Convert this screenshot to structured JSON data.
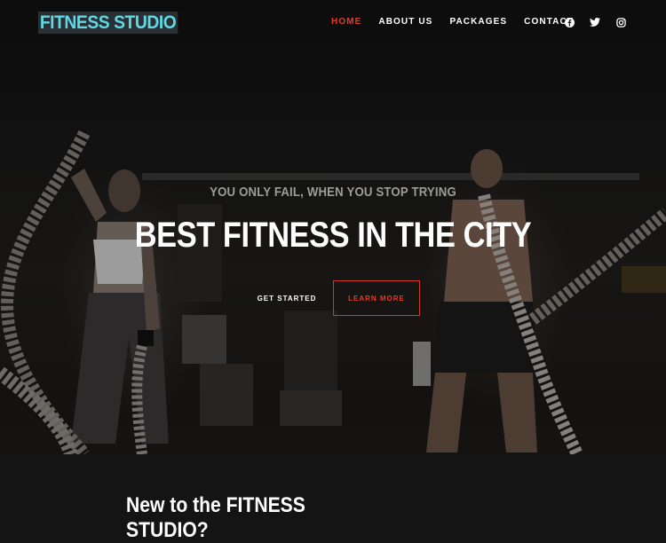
{
  "brand": {
    "logo_text": "FITNESS STUDIO"
  },
  "nav": {
    "items": [
      {
        "label": "HOME",
        "active": true
      },
      {
        "label": "ABOUT US",
        "active": false
      },
      {
        "label": "PACKAGES",
        "active": false
      },
      {
        "label": "CONTACT",
        "active": false
      }
    ],
    "social_icons": [
      "facebook-icon",
      "twitter-icon",
      "instagram-icon"
    ]
  },
  "hero": {
    "tagline": "YOU ONLY FAIL, WHEN YOU STOP TRYING",
    "headline": "BEST FITNESS IN THE CITY",
    "primary_button": "GET STARTED",
    "secondary_button": "LEARN MORE"
  },
  "intro": {
    "title": "New to the FITNESS STUDIO?"
  },
  "colors": {
    "accent": "#e43b2a",
    "logo_text": "#5fd8e6",
    "background": "#141414"
  }
}
